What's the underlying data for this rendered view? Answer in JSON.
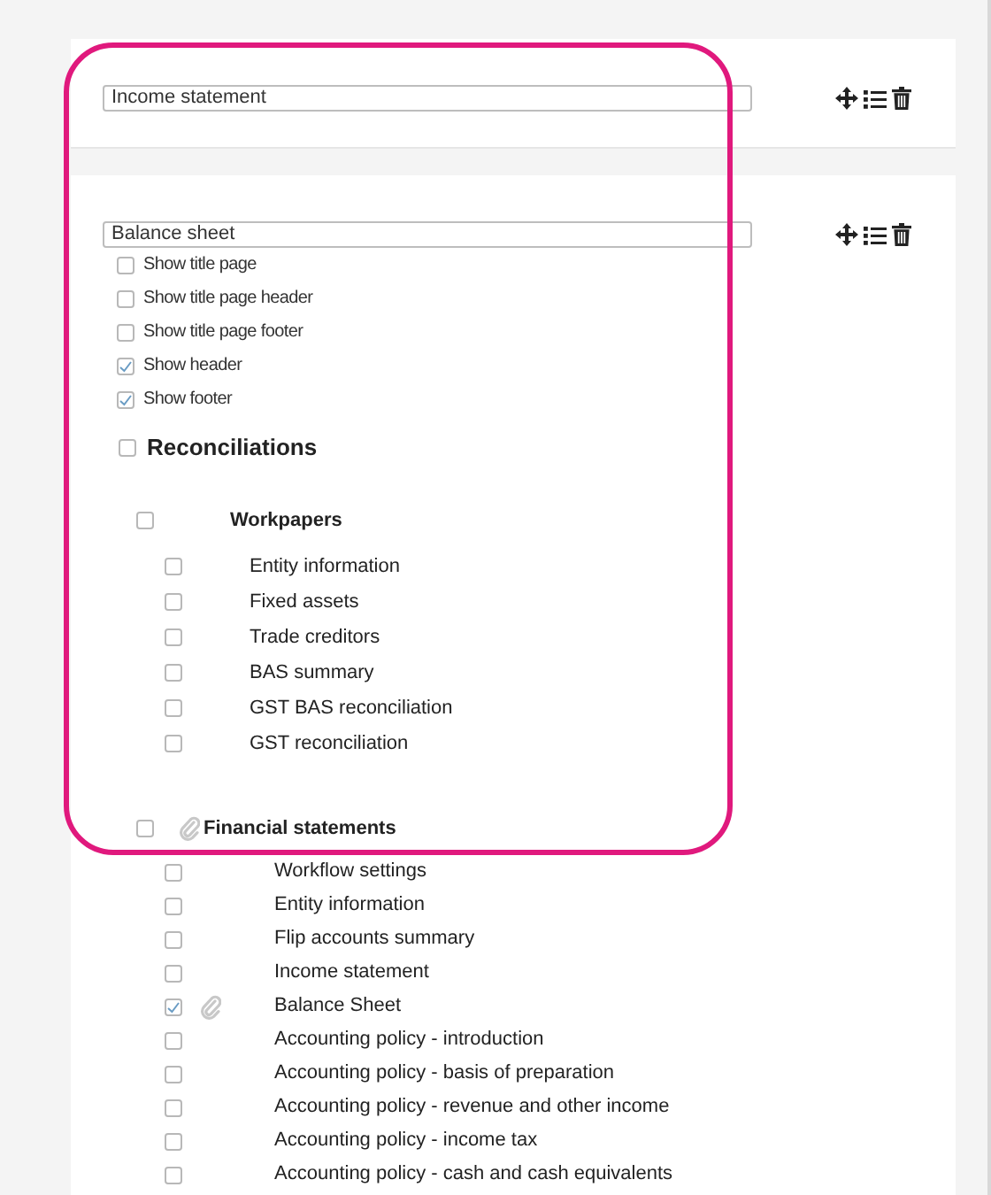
{
  "sections": [
    {
      "title_value": "Income statement"
    },
    {
      "title_value": "Balance sheet",
      "options": [
        {
          "label": "Show title page",
          "checked": false
        },
        {
          "label": "Show title page header",
          "checked": false
        },
        {
          "label": "Show title page footer",
          "checked": false
        },
        {
          "label": "Show header",
          "checked": true
        },
        {
          "label": "Show footer",
          "checked": true
        }
      ],
      "group": {
        "label": "Reconciliations",
        "checked": false,
        "children": [
          {
            "label": "Workpapers",
            "checked": false,
            "attachment": false,
            "children": [
              {
                "label": "Entity information",
                "checked": false,
                "attachment": false
              },
              {
                "label": "Fixed assets",
                "checked": false,
                "attachment": false
              },
              {
                "label": "Trade creditors",
                "checked": false,
                "attachment": false
              },
              {
                "label": "BAS summary",
                "checked": false,
                "attachment": false
              },
              {
                "label": "GST BAS reconciliation",
                "checked": false,
                "attachment": false
              },
              {
                "label": "GST reconciliation",
                "checked": false,
                "attachment": false
              }
            ]
          },
          {
            "label": "Financial statements",
            "checked": false,
            "attachment": true,
            "children": [
              {
                "label": "Workflow settings",
                "checked": false,
                "attachment": false
              },
              {
                "label": "Entity information",
                "checked": false,
                "attachment": false
              },
              {
                "label": "Flip accounts summary",
                "checked": false,
                "attachment": false
              },
              {
                "label": "Income statement",
                "checked": false,
                "attachment": false
              },
              {
                "label": "Balance Sheet",
                "checked": true,
                "attachment": true
              },
              {
                "label": "Accounting policy - introduction",
                "checked": false,
                "attachment": false
              },
              {
                "label": "Accounting policy - basis of preparation",
                "checked": false,
                "attachment": false
              },
              {
                "label": "Accounting policy - revenue and other income",
                "checked": false,
                "attachment": false
              },
              {
                "label": "Accounting policy - income tax",
                "checked": false,
                "attachment": false
              },
              {
                "label": "Accounting policy - cash and cash equivalents",
                "checked": false,
                "attachment": false
              }
            ]
          }
        ]
      }
    }
  ]
}
